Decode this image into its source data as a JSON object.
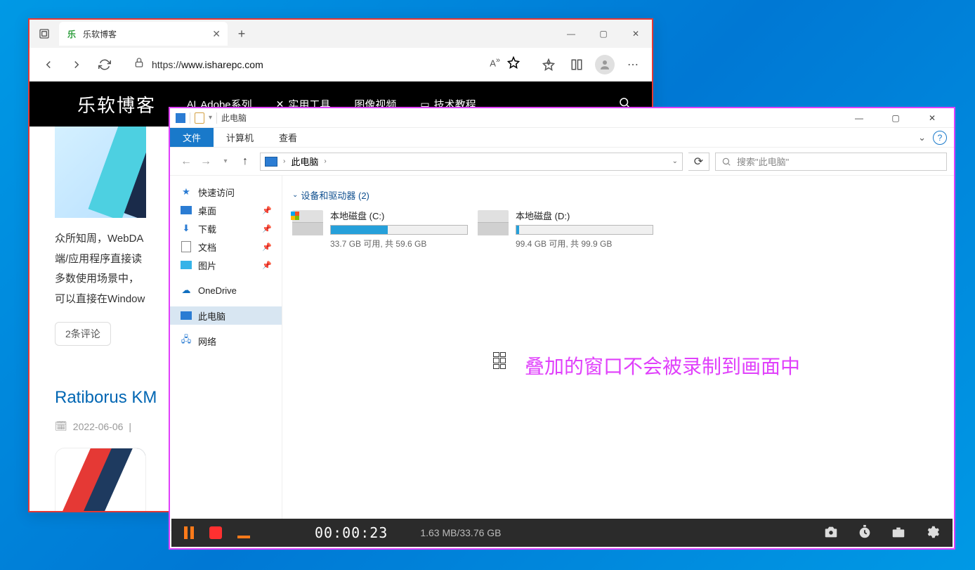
{
  "edge": {
    "tab": {
      "title": "乐软博客",
      "favicon_text": "乐"
    },
    "url_prefix": "https://",
    "url_domain": "www.isharepc.com",
    "site": {
      "logo": "乐软博客",
      "nav": [
        "Adobe系列",
        "实用工具",
        "图像视频",
        "技术教程"
      ]
    },
    "article": {
      "excerpt": "众所知周，WebDA\n端/应用程序直接读\n多数使用场景中，\n可以直接在Window",
      "comments": "2条评论",
      "title2": "Ratiborus KM",
      "date": "2022-06-06"
    }
  },
  "explorer": {
    "title": "此电脑",
    "ribbon": {
      "file": "文件",
      "computer": "计算机",
      "view": "查看"
    },
    "path_label": "此电脑",
    "search_placeholder": "搜索\"此电脑\"",
    "sidebar": {
      "quick": "快速访问",
      "desktop": "桌面",
      "downloads": "下载",
      "documents": "文档",
      "pictures": "图片",
      "onedrive": "OneDrive",
      "thispc": "此电脑",
      "network": "网络"
    },
    "group": "设备和驱动器 (2)",
    "drives": [
      {
        "label": "本地磁盘 (C:)",
        "stats": "33.7 GB 可用, 共 59.6 GB",
        "fill_pct": 42
      },
      {
        "label": "本地磁盘 (D:)",
        "stats": "99.4 GB 可用, 共 99.9 GB",
        "fill_pct": 2
      }
    ],
    "annotation": "叠加的窗口不会被录制到画面中"
  },
  "recorder": {
    "time": "00:00:23",
    "size": "1.63 MB/33.76 GB"
  }
}
